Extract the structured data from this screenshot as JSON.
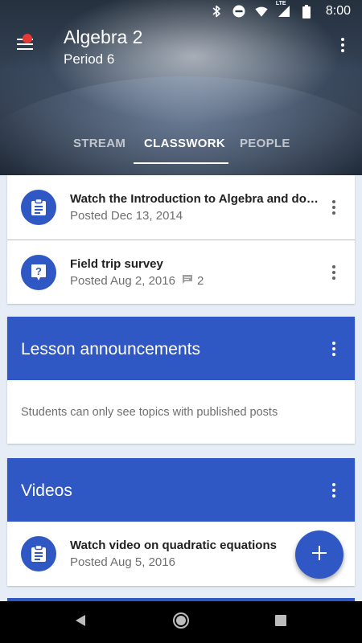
{
  "status_bar": {
    "time": "8:00",
    "network_label": "LTE",
    "icons": [
      "bluetooth-icon",
      "do-not-disturb-icon",
      "wifi-icon",
      "cell-signal-icon",
      "battery-icon"
    ]
  },
  "header": {
    "title": "Algebra 2",
    "subtitle": "Period 6",
    "has_notification_dot": true
  },
  "tabs": [
    {
      "label": "STREAM",
      "active": false
    },
    {
      "label": "CLASSWORK",
      "active": true
    },
    {
      "label": "PEOPLE",
      "active": false
    }
  ],
  "assignments": [
    {
      "title": "Watch the Introduction to Algebra and do the worksheet",
      "meta": "Posted Dec 13, 2014",
      "icon": "assignment-icon"
    },
    {
      "title": "Field trip survey",
      "meta": "Posted Aug 2, 2016",
      "comments": "2",
      "icon": "question-icon"
    }
  ],
  "topics": [
    {
      "title": "Lesson announcements",
      "empty_text": "Students can only see topics with published posts"
    },
    {
      "title": "Videos",
      "items": [
        {
          "title": "Watch video on quadratic equations",
          "meta": "Posted Aug 5, 2016",
          "icon": "assignment-icon"
        }
      ]
    }
  ],
  "colors": {
    "accent": "#3058c4",
    "notification": "#e53935",
    "background": "#e6edf6"
  }
}
